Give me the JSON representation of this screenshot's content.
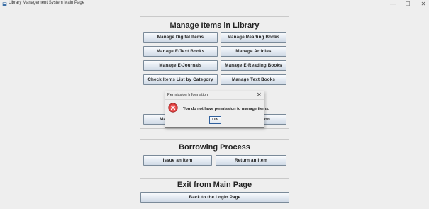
{
  "window": {
    "title": "Library Management System Main Page",
    "controls": {
      "minimize": "—",
      "maximize": "☐",
      "close": "✕"
    }
  },
  "manage_items": {
    "title": "Manage Items in Library",
    "buttons": {
      "digital_items": "Manage Digital Items",
      "reading_books": "Manage Reading Books",
      "etext_books": "Manage E-Text Books",
      "articles": "Manage Articles",
      "ejournals": "Manage E-Journals",
      "ereading_books": "Manage E-Reading Books",
      "check_items_list": "Check Items List by Category",
      "text_books": "Manage Text Books"
    }
  },
  "middle_panel": {
    "left_button_partial": "Ma",
    "right_button_partial": "ation"
  },
  "borrowing": {
    "title": "Borrowing Process",
    "issue": "Issue an Item",
    "return": "Return an Item"
  },
  "exit": {
    "title": "Exit from Main Page",
    "back": "Back to the Login Page"
  },
  "dialog": {
    "title": "Permission Information",
    "close": "✕",
    "message": "You do not have permission to manage items.",
    "ok": "OK",
    "icon": "error-icon"
  },
  "colors": {
    "background": "#eeeeee",
    "button_gradient_top": "#fbfcfe",
    "button_gradient_bottom": "#cfd9e5",
    "error_red": "#d63a3a"
  }
}
